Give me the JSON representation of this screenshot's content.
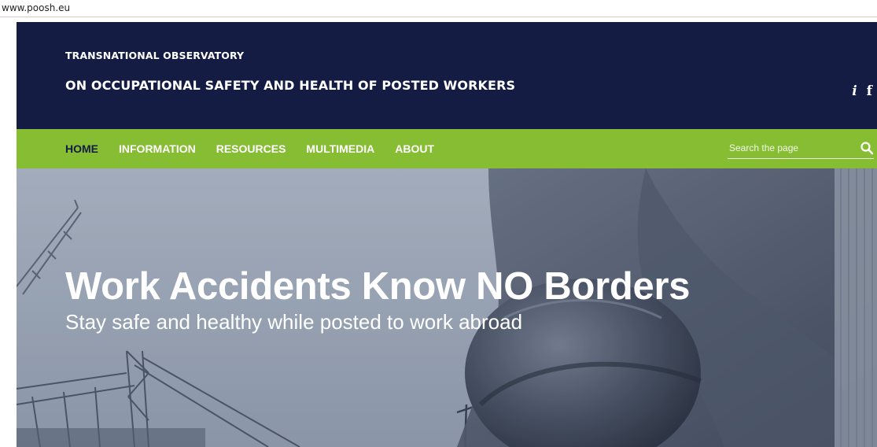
{
  "browser": {
    "url": "www.poosh.eu"
  },
  "header": {
    "title_top": "TRANSNATIONAL OBSERVATORY",
    "title_main": "ON OCCUPATIONAL SAFETY AND HEALTH OF POSTED WORKERS",
    "social": [
      {
        "label": "i",
        "icon": "info-icon"
      },
      {
        "label": "f",
        "icon": "facebook-icon"
      }
    ]
  },
  "nav": {
    "items": [
      {
        "label": "HOME",
        "active": true
      },
      {
        "label": "INFORMATION",
        "active": false
      },
      {
        "label": "RESOURCES",
        "active": false
      },
      {
        "label": "MULTIMEDIA",
        "active": false
      },
      {
        "label": "ABOUT",
        "active": false
      }
    ],
    "search_placeholder": "Search the page"
  },
  "hero": {
    "headline": "Work Accidents Know NO Borders",
    "subtitle": "Stay safe and healthy while posted to work abroad"
  },
  "colors": {
    "header_bg": "#141c44",
    "nav_bg": "#86bd33",
    "active_nav": "#141c44",
    "text_light": "#ffffff"
  }
}
